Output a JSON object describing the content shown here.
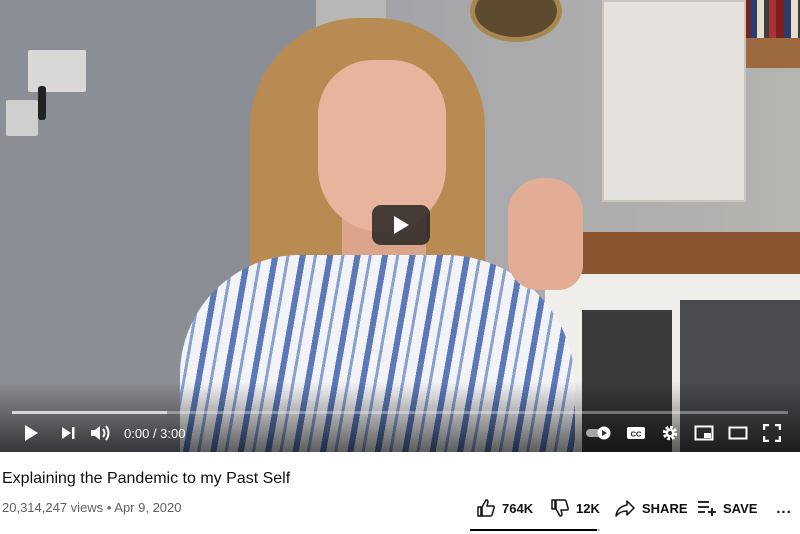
{
  "video": {
    "title": "Explaining the Pandemic to my Past Self",
    "views": "20,314,247 views",
    "separator": "•",
    "date": "Apr 9, 2020"
  },
  "player": {
    "time_display": "0:00 / 3:00",
    "progress_fraction": 0,
    "loaded_fraction": 0.2,
    "autoplay_toggle": "on"
  },
  "actions": {
    "likes": "764K",
    "dislikes": "12K",
    "share": "SHARE",
    "save": "SAVE",
    "more": "..."
  },
  "sentiment": {
    "like_fraction": 0.98
  },
  "icons": [
    "play-icon",
    "next-icon",
    "volume-icon",
    "autoplay-icon",
    "captions-icon",
    "settings-icon",
    "miniplayer-icon",
    "theater-icon",
    "fullscreen-icon",
    "thumbs-up-icon",
    "thumbs-down-icon",
    "share-icon",
    "save-icon",
    "more-icon"
  ]
}
